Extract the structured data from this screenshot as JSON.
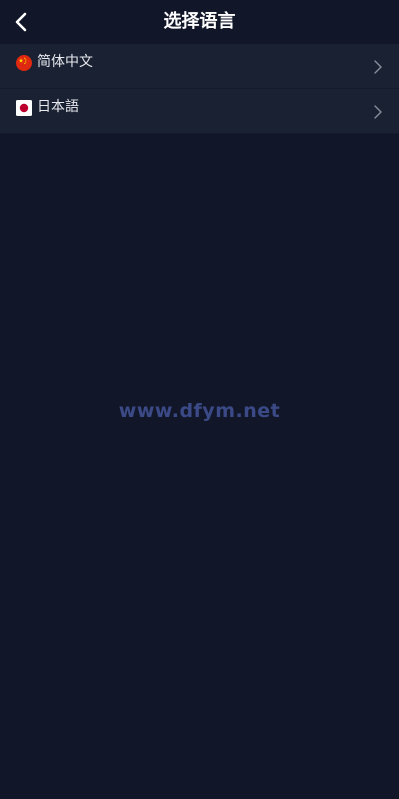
{
  "header": {
    "title": "选择语言",
    "back_icon": "chevron-left-icon"
  },
  "languages": [
    {
      "label": "简体中文",
      "flag": "china-flag-icon"
    },
    {
      "label": "日本語",
      "flag": "japan-flag-icon"
    }
  ],
  "watermark": "www.dfym.net",
  "colors": {
    "background": "#111729",
    "row_background": "#192133",
    "text": "#e8e9ee",
    "watermark": "#3b4a86"
  }
}
